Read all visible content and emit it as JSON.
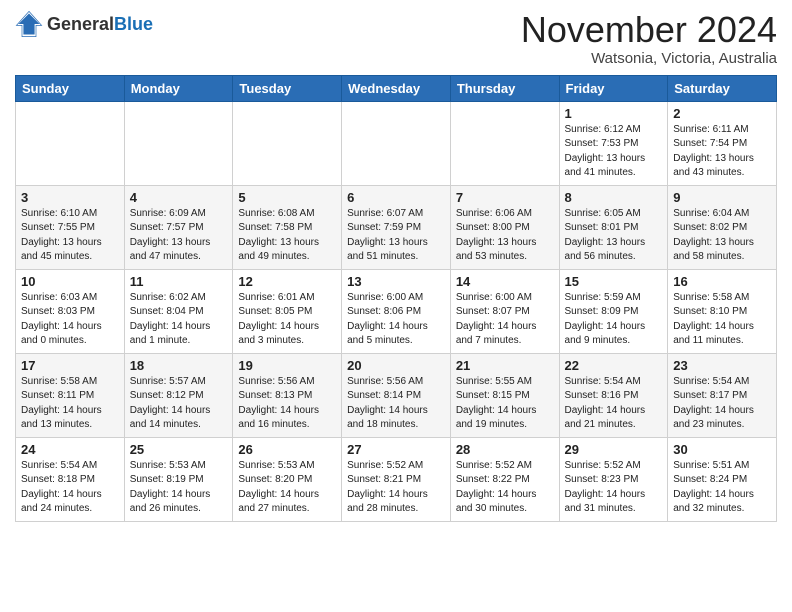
{
  "header": {
    "logo_general": "General",
    "logo_blue": "Blue",
    "month": "November 2024",
    "location": "Watsonia, Victoria, Australia"
  },
  "days_of_week": [
    "Sunday",
    "Monday",
    "Tuesday",
    "Wednesday",
    "Thursday",
    "Friday",
    "Saturday"
  ],
  "weeks": [
    [
      {
        "day": "",
        "info": ""
      },
      {
        "day": "",
        "info": ""
      },
      {
        "day": "",
        "info": ""
      },
      {
        "day": "",
        "info": ""
      },
      {
        "day": "",
        "info": ""
      },
      {
        "day": "1",
        "info": "Sunrise: 6:12 AM\nSunset: 7:53 PM\nDaylight: 13 hours\nand 41 minutes."
      },
      {
        "day": "2",
        "info": "Sunrise: 6:11 AM\nSunset: 7:54 PM\nDaylight: 13 hours\nand 43 minutes."
      }
    ],
    [
      {
        "day": "3",
        "info": "Sunrise: 6:10 AM\nSunset: 7:55 PM\nDaylight: 13 hours\nand 45 minutes."
      },
      {
        "day": "4",
        "info": "Sunrise: 6:09 AM\nSunset: 7:57 PM\nDaylight: 13 hours\nand 47 minutes."
      },
      {
        "day": "5",
        "info": "Sunrise: 6:08 AM\nSunset: 7:58 PM\nDaylight: 13 hours\nand 49 minutes."
      },
      {
        "day": "6",
        "info": "Sunrise: 6:07 AM\nSunset: 7:59 PM\nDaylight: 13 hours\nand 51 minutes."
      },
      {
        "day": "7",
        "info": "Sunrise: 6:06 AM\nSunset: 8:00 PM\nDaylight: 13 hours\nand 53 minutes."
      },
      {
        "day": "8",
        "info": "Sunrise: 6:05 AM\nSunset: 8:01 PM\nDaylight: 13 hours\nand 56 minutes."
      },
      {
        "day": "9",
        "info": "Sunrise: 6:04 AM\nSunset: 8:02 PM\nDaylight: 13 hours\nand 58 minutes."
      }
    ],
    [
      {
        "day": "10",
        "info": "Sunrise: 6:03 AM\nSunset: 8:03 PM\nDaylight: 14 hours\nand 0 minutes."
      },
      {
        "day": "11",
        "info": "Sunrise: 6:02 AM\nSunset: 8:04 PM\nDaylight: 14 hours\nand 1 minute."
      },
      {
        "day": "12",
        "info": "Sunrise: 6:01 AM\nSunset: 8:05 PM\nDaylight: 14 hours\nand 3 minutes."
      },
      {
        "day": "13",
        "info": "Sunrise: 6:00 AM\nSunset: 8:06 PM\nDaylight: 14 hours\nand 5 minutes."
      },
      {
        "day": "14",
        "info": "Sunrise: 6:00 AM\nSunset: 8:07 PM\nDaylight: 14 hours\nand 7 minutes."
      },
      {
        "day": "15",
        "info": "Sunrise: 5:59 AM\nSunset: 8:09 PM\nDaylight: 14 hours\nand 9 minutes."
      },
      {
        "day": "16",
        "info": "Sunrise: 5:58 AM\nSunset: 8:10 PM\nDaylight: 14 hours\nand 11 minutes."
      }
    ],
    [
      {
        "day": "17",
        "info": "Sunrise: 5:58 AM\nSunset: 8:11 PM\nDaylight: 14 hours\nand 13 minutes."
      },
      {
        "day": "18",
        "info": "Sunrise: 5:57 AM\nSunset: 8:12 PM\nDaylight: 14 hours\nand 14 minutes."
      },
      {
        "day": "19",
        "info": "Sunrise: 5:56 AM\nSunset: 8:13 PM\nDaylight: 14 hours\nand 16 minutes."
      },
      {
        "day": "20",
        "info": "Sunrise: 5:56 AM\nSunset: 8:14 PM\nDaylight: 14 hours\nand 18 minutes."
      },
      {
        "day": "21",
        "info": "Sunrise: 5:55 AM\nSunset: 8:15 PM\nDaylight: 14 hours\nand 19 minutes."
      },
      {
        "day": "22",
        "info": "Sunrise: 5:54 AM\nSunset: 8:16 PM\nDaylight: 14 hours\nand 21 minutes."
      },
      {
        "day": "23",
        "info": "Sunrise: 5:54 AM\nSunset: 8:17 PM\nDaylight: 14 hours\nand 23 minutes."
      }
    ],
    [
      {
        "day": "24",
        "info": "Sunrise: 5:54 AM\nSunset: 8:18 PM\nDaylight: 14 hours\nand 24 minutes."
      },
      {
        "day": "25",
        "info": "Sunrise: 5:53 AM\nSunset: 8:19 PM\nDaylight: 14 hours\nand 26 minutes."
      },
      {
        "day": "26",
        "info": "Sunrise: 5:53 AM\nSunset: 8:20 PM\nDaylight: 14 hours\nand 27 minutes."
      },
      {
        "day": "27",
        "info": "Sunrise: 5:52 AM\nSunset: 8:21 PM\nDaylight: 14 hours\nand 28 minutes."
      },
      {
        "day": "28",
        "info": "Sunrise: 5:52 AM\nSunset: 8:22 PM\nDaylight: 14 hours\nand 30 minutes."
      },
      {
        "day": "29",
        "info": "Sunrise: 5:52 AM\nSunset: 8:23 PM\nDaylight: 14 hours\nand 31 minutes."
      },
      {
        "day": "30",
        "info": "Sunrise: 5:51 AM\nSunset: 8:24 PM\nDaylight: 14 hours\nand 32 minutes."
      }
    ]
  ]
}
